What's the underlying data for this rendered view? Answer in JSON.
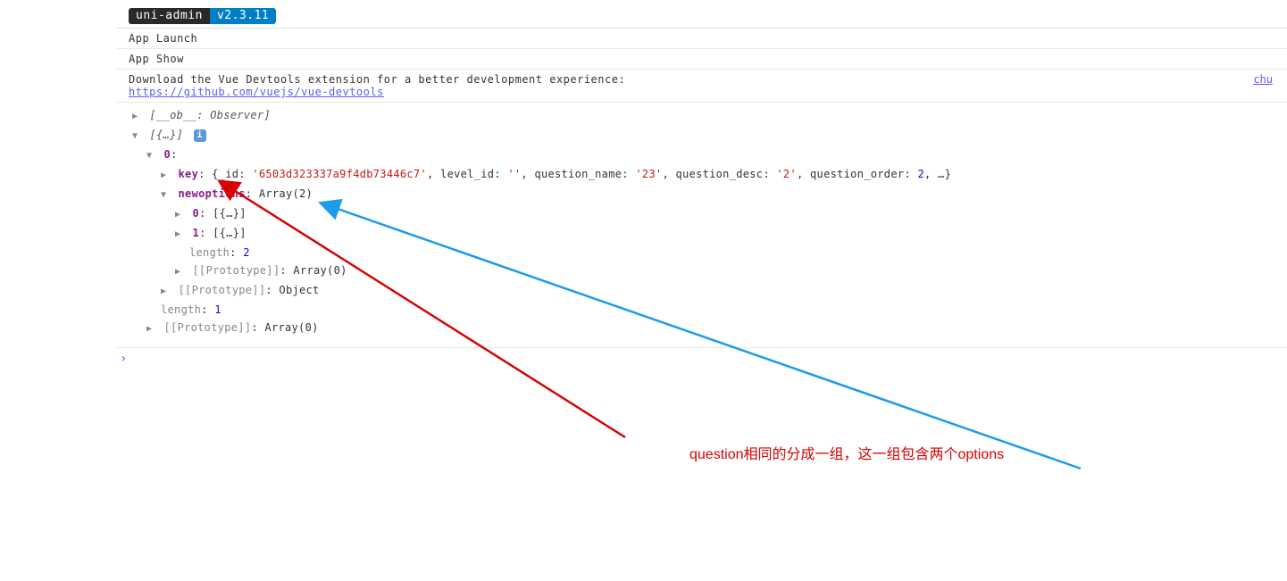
{
  "header": {
    "badge_name": "uni-admin",
    "badge_version": "v2.3.11"
  },
  "logs": {
    "launch": "App Launch",
    "show": "App Show",
    "devtools_msg": "Download the Vue Devtools extension for a better development experience:",
    "devtools_url": "https://github.com/vuejs/vue-devtools",
    "source_ref": "chu"
  },
  "tree": {
    "observer": "[__ob__: Observer]",
    "root_label": "[{…}]",
    "idx0": "0",
    "key_label": "key",
    "key_obj": {
      "_id_label": "_id",
      "_id": "'6503d323337a9f4db73446c7'",
      "level_id_label": "level_id",
      "level_id": "''",
      "question_name_label": "question_name",
      "question_name": "'23'",
      "question_desc_label": "question_desc",
      "question_desc": "'2'",
      "question_order_label": "question_order",
      "question_order": "2",
      "ellipsis": "…"
    },
    "newoptions_label": "newoptions",
    "newoptions_type": "Array(2)",
    "opt0": "0",
    "opt0_val": "[{…}]",
    "opt1": "1",
    "opt1_val": "[{…}]",
    "length_label": "length",
    "length_val_2": "2",
    "proto_arr0": "Array(0)",
    "proto_label": "[[Prototype]]",
    "proto_obj": "Object",
    "outer_length_label": "length",
    "outer_length_val": "1",
    "outer_proto_arr0": "Array(0)"
  },
  "annotation": {
    "text": "question相同的分成一组，这一组包含两个options"
  },
  "prompt": "›"
}
